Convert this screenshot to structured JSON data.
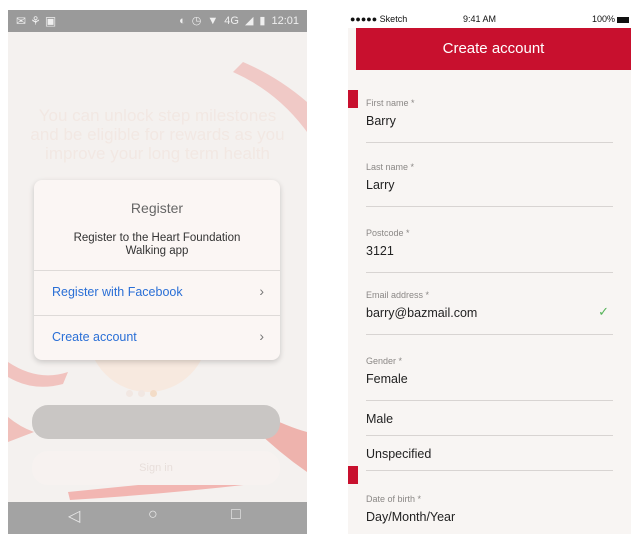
{
  "left_screen": {
    "status_bar": {
      "icons": [
        "notification-icon",
        "usb-icon",
        "image-icon"
      ],
      "right_icons": [
        "cast-icon",
        "alarm-icon",
        "wifi-icon",
        "4g-icon",
        "signal-icon",
        "battery-icon"
      ],
      "time": "12:01"
    },
    "background_text": "You can unlock step milestones and be eligible for rewards as you improve your long term health",
    "register_dialog": {
      "title": "Register",
      "description": "Register to the Heart Foundation Walking app",
      "options": [
        {
          "label": "Register with Facebook",
          "chevron": "›"
        },
        {
          "label": "Create account",
          "chevron": "›"
        }
      ]
    },
    "signin_label": "Sign in",
    "nav_bar": {
      "back": "◁",
      "home": "○",
      "recents": "□"
    },
    "colors": {
      "accent_link": "#2a6fd6",
      "swoosh": "#c8102e"
    }
  },
  "right_screen": {
    "status_bar": {
      "carrier": "●●●●● Sketch",
      "time": "9:41 AM",
      "battery": "100%"
    },
    "header_title": "Create account",
    "fields": [
      {
        "label": "First name *",
        "value": "Barry"
      },
      {
        "label": "Last name *",
        "value": "Larry"
      },
      {
        "label": "Postcode *",
        "value": "3121"
      },
      {
        "label": "Email address *",
        "value": "barry@bazmail.com",
        "valid": true,
        "check": "✓"
      },
      {
        "label": "Gender *",
        "value": "Female"
      }
    ],
    "gender_options": [
      "Male",
      "Unspecified"
    ],
    "dob": {
      "label": "Date of birth *",
      "value": "Day/Month/Year"
    },
    "colors": {
      "header": "#c8102e",
      "valid": "#57b45a"
    }
  }
}
